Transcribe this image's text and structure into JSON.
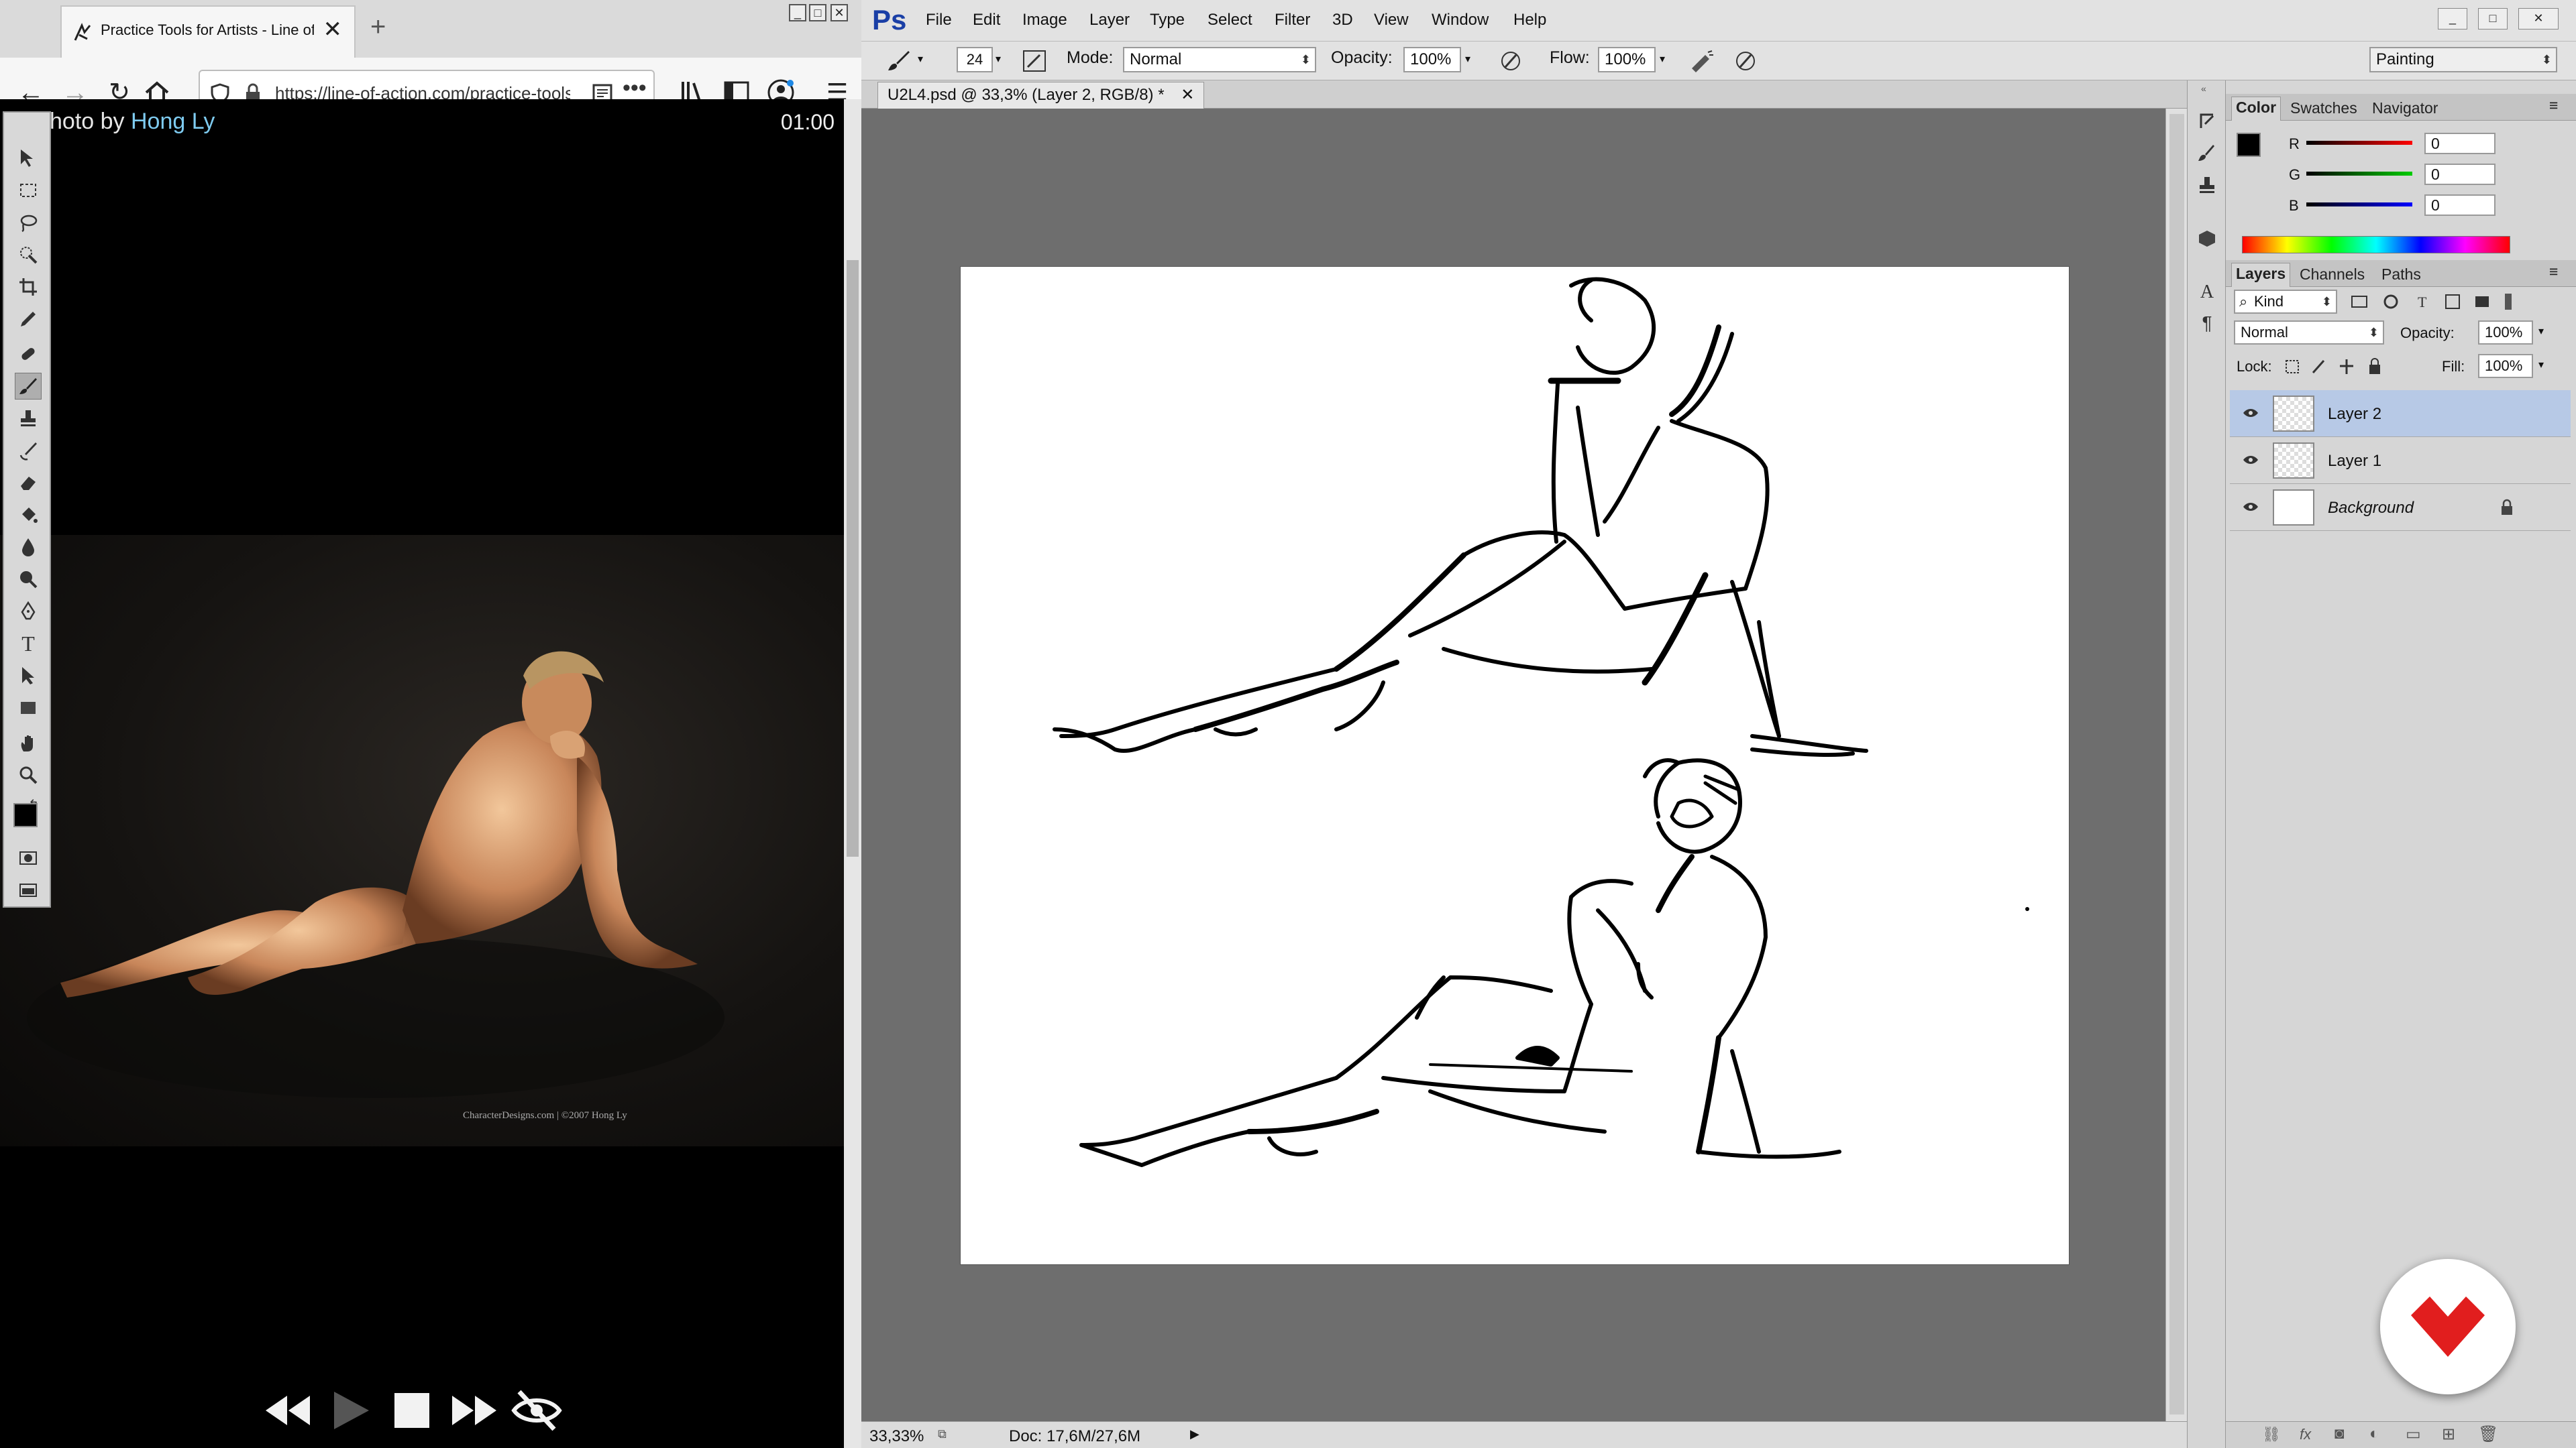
{
  "browser": {
    "tab_title": "Practice Tools for Artists - Line of Action",
    "url": "https://line-of-action.com/practice-tools/",
    "photo_credit_prefix": "hoto by",
    "photo_credit_name": "Hong Ly",
    "timer": "01:00",
    "watermark": "CharacterDesigns.com | ©2007 Hong Ly",
    "icons": {
      "back": "arrow-left",
      "forward": "arrow-right",
      "reload": "reload",
      "home": "home",
      "shield": "shield",
      "lock": "lock",
      "reader": "reader-view",
      "more": "more-dots",
      "library": "library",
      "sidebar": "sidebar",
      "account": "account",
      "menu": "hamburger"
    },
    "controls": [
      "previous",
      "play",
      "stop",
      "next",
      "hide-image"
    ]
  },
  "photoshop": {
    "app_logo": "Ps",
    "menu": [
      "File",
      "Edit",
      "Image",
      "Layer",
      "Type",
      "Select",
      "Filter",
      "3D",
      "View",
      "Window",
      "Help"
    ],
    "options": {
      "brush_size": "24",
      "mode_label": "Mode:",
      "mode_value": "Normal",
      "opacity_label": "Opacity:",
      "opacity_value": "100%",
      "flow_label": "Flow:",
      "flow_value": "100%",
      "workspace": "Painting"
    },
    "document_tab": "U2L4.psd @ 33,3% (Layer 2, RGB/8) *",
    "status": {
      "zoom": "33,33%",
      "doc": "Doc: 17,6M/27,6M"
    },
    "color_panel": {
      "tabs": [
        "Color",
        "Swatches",
        "Navigator"
      ],
      "channels": [
        {
          "label": "R",
          "value": "0",
          "color": "#e02020"
        },
        {
          "label": "G",
          "value": "0",
          "color": "#20b020"
        },
        {
          "label": "B",
          "value": "0",
          "color": "#2030d0"
        }
      ]
    },
    "layers_panel": {
      "tabs": [
        "Layers",
        "Channels",
        "Paths"
      ],
      "filter": "Kind",
      "blend": "Normal",
      "opacity_label": "Opacity:",
      "opacity_value": "100%",
      "lock_label": "Lock:",
      "fill_label": "Fill:",
      "fill_value": "100%",
      "layers": [
        {
          "name": "Layer 2",
          "selected": true
        },
        {
          "name": "Layer 1",
          "selected": false
        },
        {
          "name": "Background",
          "selected": false,
          "locked": true
        }
      ]
    }
  },
  "colors": {
    "ps_blue": "#1a3fa6",
    "layer_selected": "#b7c9e6",
    "badge_red": "#e11e1e"
  }
}
